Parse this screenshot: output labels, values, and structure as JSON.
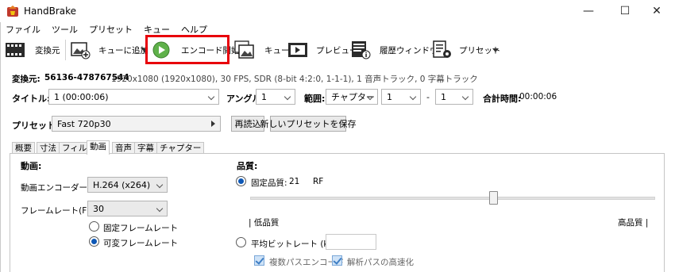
{
  "window": {
    "title": "HandBrake",
    "controls": [
      "—",
      "☐",
      "✕"
    ]
  },
  "menu": [
    "ファイル",
    "ツール",
    "プリセット",
    "キュー",
    "ヘルプ"
  ],
  "toolbar": {
    "source_label": "変換元",
    "add_queue_label": "キューに追加",
    "start_encode_label": "エンコード開始",
    "queue_label": "キュー",
    "preview_label": "プレビュー",
    "activity_label": "履歴ウィンドウ",
    "presets_label": "プリセット"
  },
  "source": {
    "label": "変換元:",
    "name": "56136-478767544",
    "info": "1920x1080 (1920x1080), 30 FPS, SDR (8-bit 4:2:0, 1-1-1), 1 音声トラック, 0 字幕トラック"
  },
  "title_row": {
    "title_label": "タイトル:",
    "title_value": "1  (00:00:06)",
    "angle_label": "アングル:",
    "angle_value": "1",
    "range_label": "範囲:",
    "range_type": "チャプター",
    "range_start": "1",
    "range_dash": "-",
    "range_end": "1",
    "duration_label": "合計時間:",
    "duration_value": "00:00:06"
  },
  "preset_row": {
    "label": "プリセット:",
    "value": "Fast 720p30",
    "reload_label": "再読込",
    "save_new_label": "新しいプリセットを保存"
  },
  "tabs": [
    "概要",
    "寸法",
    "フィルタ",
    "動画",
    "音声",
    "字幕",
    "チャプター"
  ],
  "active_tab": "動画",
  "video": {
    "section_label": "動画:",
    "encoder_label": "動画エンコーダー:",
    "encoder_value": "H.264 (x264)",
    "framerate_label": "フレームレート(FPS):",
    "framerate_value": "30",
    "cfr_label": "固定フレームレート",
    "vfr_label": "可変フレームレート"
  },
  "quality": {
    "section_label": "品質:",
    "cq_label": "固定品質:",
    "cq_value": "21",
    "cq_unit": "RF",
    "slider_level": 0.6,
    "low_label": "| 低品質",
    "high_label": "高品質 |",
    "abr_label": "平均ビットレート (kbps):",
    "abr_value": "",
    "twopass_label": "複数パスエンコード",
    "turbo_label": "解析パスの高速化"
  }
}
